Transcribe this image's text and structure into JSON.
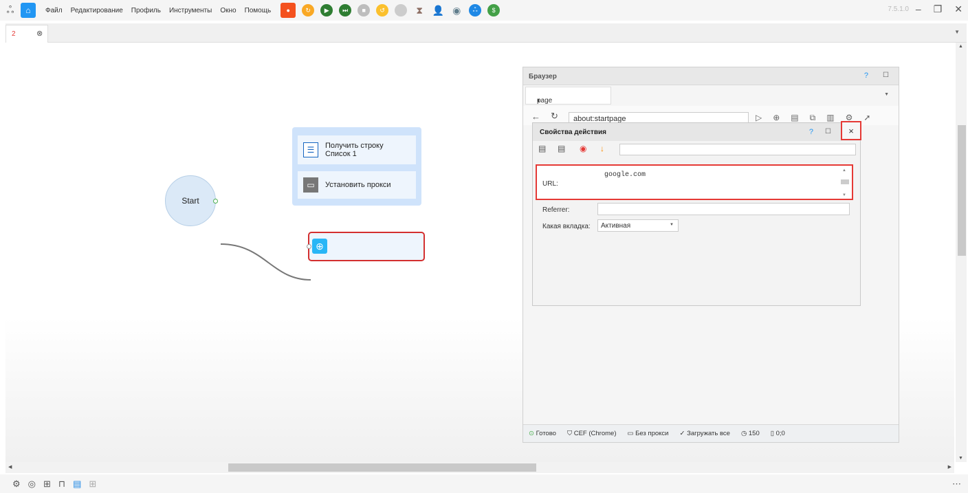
{
  "topbar": {
    "menu": [
      "Файл",
      "Редактирование",
      "Профиль",
      "Инструменты",
      "Окно",
      "Помощь"
    ],
    "version": "7.5.1.0"
  },
  "tabs": {
    "active_number": "2"
  },
  "nodes": {
    "start": "Start",
    "group_items": [
      {
        "icon": "list-icon",
        "line1": "Получить строку",
        "line2": "Список 1"
      },
      {
        "icon": "monitor-icon",
        "line1": "Установить прокси",
        "line2": ""
      }
    ],
    "action_icon": "globe-icon"
  },
  "browser": {
    "title": "Браузер",
    "help": "?",
    "tab_label": "page",
    "address": "about:startpage"
  },
  "props": {
    "title": "Свойства действия",
    "help": "?",
    "close": "×",
    "url_label": "URL:",
    "url_value": "google.com",
    "referrer_label": "Referrer:",
    "tab_label": "Какая вкладка:",
    "tab_value": "Активная"
  },
  "status": {
    "ready": "Готово",
    "engine": "CEF (Chrome)",
    "proxy": "Без прокси",
    "load": "Загружать все",
    "timeout": "150",
    "coords": "0;0"
  },
  "colors": {
    "accent": "#2196f3",
    "highlight": "#e53935",
    "group_bg": "#cfe3fb"
  }
}
